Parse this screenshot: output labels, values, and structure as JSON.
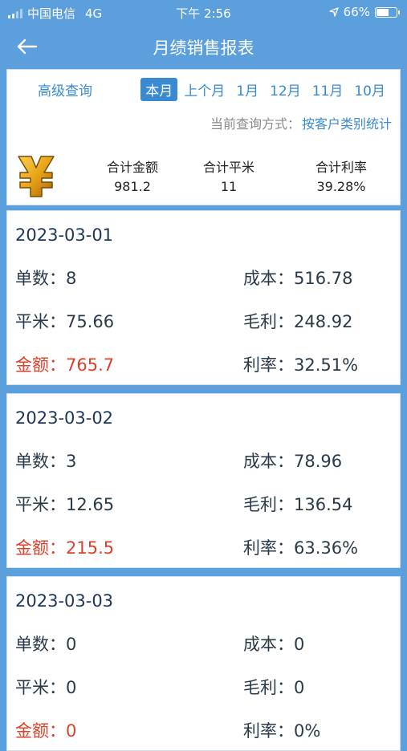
{
  "status_bar": {
    "carrier": "中国电信",
    "network": "4G",
    "time": "下午 2:56",
    "battery": "66%",
    "battery_level": 0.66
  },
  "nav": {
    "title": "月绩销售报表"
  },
  "filter": {
    "advanced_query": "高级查询",
    "months": [
      "本月",
      "上个月",
      "1月",
      "12月",
      "11月",
      "10月"
    ],
    "active_month": "本月",
    "query_mode_label": "当前查询方式：",
    "query_mode_value": "按客户类别统计"
  },
  "totals": {
    "amount_label": "合计金额",
    "amount_value": "981.2",
    "area_label": "合计平米",
    "area_value": "11",
    "rate_label": "合计利率",
    "rate_value": "39.28%"
  },
  "cards": [
    {
      "date": "2023-03-01",
      "orders_label": "单数：",
      "orders": "8",
      "cost_label": "成本：",
      "cost": "516.78",
      "area_label": "平米：",
      "area": "75.66",
      "profit_label": "毛利：",
      "profit": "248.92",
      "amount_label": "金额：",
      "amount": "765.7",
      "rate_label": "利率：",
      "rate": "32.51%"
    },
    {
      "date": "2023-03-02",
      "orders_label": "单数：",
      "orders": "3",
      "cost_label": "成本：",
      "cost": "78.96",
      "area_label": "平米：",
      "area": "12.65",
      "profit_label": "毛利：",
      "profit": "136.54",
      "amount_label": "金额：",
      "amount": "215.5",
      "rate_label": "利率：",
      "rate": "63.36%"
    },
    {
      "date": "2023-03-03",
      "orders_label": "单数：",
      "orders": "0",
      "cost_label": "成本：",
      "cost": "0",
      "area_label": "平米：",
      "area": "0",
      "profit_label": "毛利：",
      "profit": "0",
      "amount_label": "金额：",
      "amount": "0",
      "rate_label": "利率：",
      "rate": "0%"
    }
  ],
  "colors": {
    "header_bg": "#5b9fdc",
    "accent": "#3a8ad2",
    "amount_red": "#d9412a",
    "yen_gold": "#e8a317"
  }
}
